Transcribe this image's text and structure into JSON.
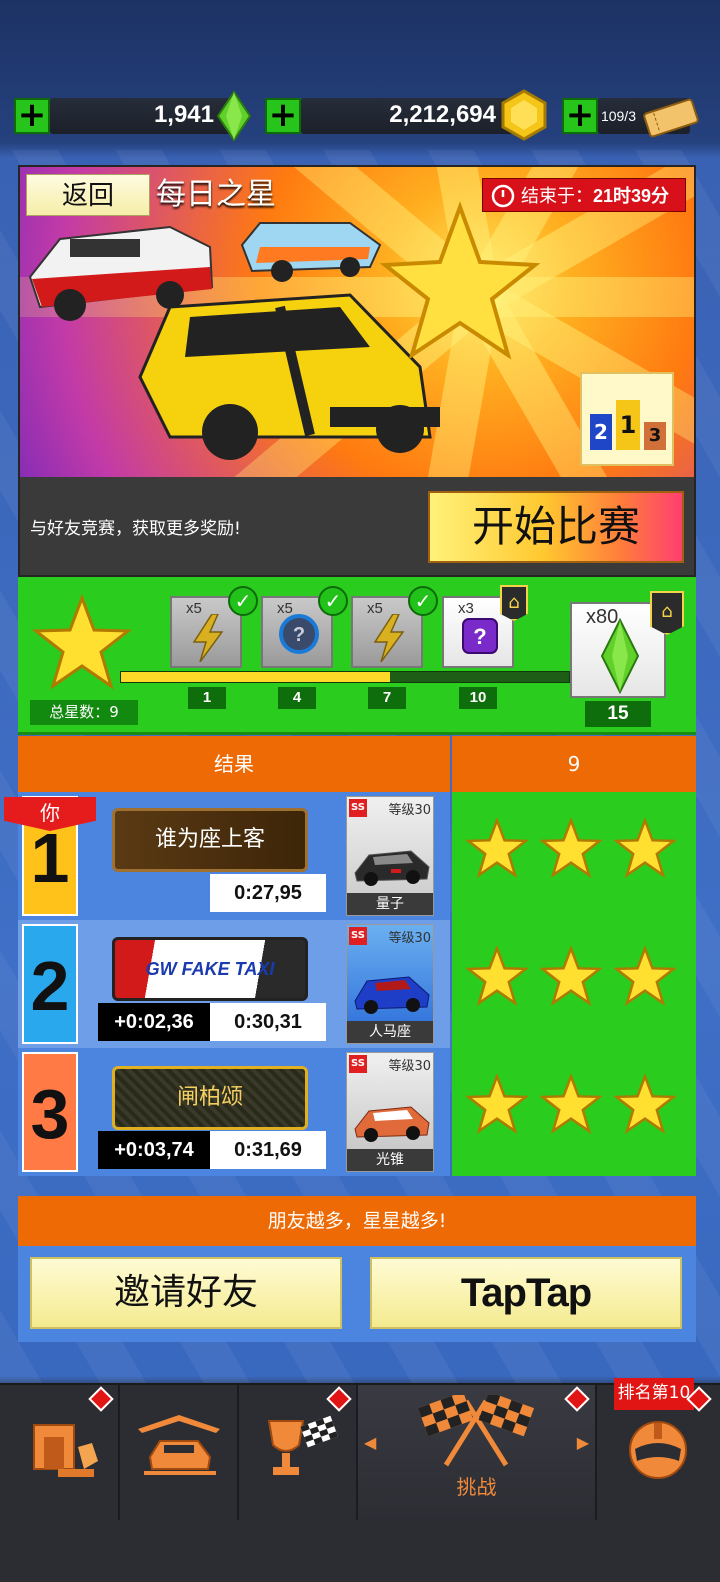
{
  "topbar": {
    "gems": "1,941",
    "coins": "2,212,694",
    "tickets": "109/3",
    "gem_color": "#5fd12a",
    "coin_color": "#f5c518"
  },
  "event": {
    "back_label": "返回",
    "title": "每日之星",
    "ends_label": "结束于：",
    "ends_time": "21时39分",
    "description": "与好友竞赛，获取更多奖励!",
    "start_label": "开始比赛",
    "podium": [
      "2",
      "1",
      "3"
    ]
  },
  "progress": {
    "total_label": "总星数：9",
    "current_stars": 9,
    "max_stars": 15,
    "tiers": [
      {
        "count": "x5",
        "item": "lightning-bolt",
        "threshold": "1",
        "claimed": true
      },
      {
        "count": "x5",
        "item": "mystery-token",
        "threshold": "4",
        "claimed": true
      },
      {
        "count": "x5",
        "item": "lightning-bolt",
        "threshold": "7",
        "claimed": true
      },
      {
        "count": "x3",
        "item": "mystery-box",
        "threshold": "10",
        "claimed": false
      },
      {
        "count": "x80",
        "item": "gem",
        "threshold": "15",
        "claimed": false
      }
    ]
  },
  "results": {
    "header_label": "结果",
    "header_value": "9",
    "you_label": "你",
    "rows": [
      {
        "rank": "1",
        "plate": "谁为座上客",
        "gap": "",
        "time": "0:27,95",
        "car_level": "等级30",
        "car_name": "量子",
        "stars": 3,
        "rank_color": "#ffc21a"
      },
      {
        "rank": "2",
        "plate": "GW FAKE TAXI",
        "gap": "+0:02,36",
        "time": "0:30,31",
        "car_level": "等级30",
        "car_name": "人马座",
        "stars": 3,
        "rank_color": "#2aa8ee"
      },
      {
        "rank": "3",
        "plate": "闸柏颂",
        "gap": "+0:03,74",
        "time": "0:31,69",
        "car_level": "等级30",
        "car_name": "光锥",
        "stars": 3,
        "rank_color": "#ff7a45"
      }
    ]
  },
  "friends": {
    "banner": "朋友越多，星星越多!",
    "invite_label": "邀请好友",
    "taptap_label": "TapTap"
  },
  "nav": {
    "challenge_label": "挑战",
    "rank_badge": "排名第10"
  }
}
